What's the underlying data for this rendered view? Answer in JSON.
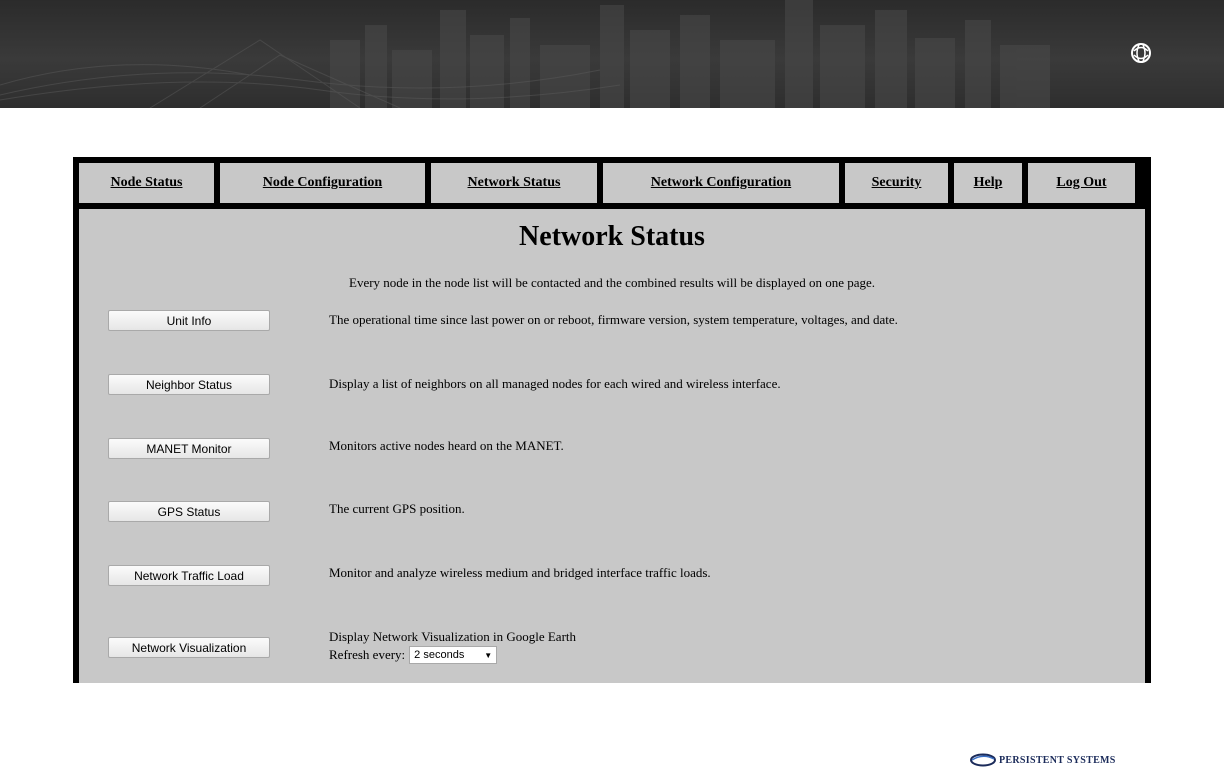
{
  "nav": {
    "tabs": [
      {
        "label": "Node Status"
      },
      {
        "label": "Node Configuration"
      },
      {
        "label": "Network Status"
      },
      {
        "label": "Network Configuration"
      },
      {
        "label": "Security"
      },
      {
        "label": "Help"
      },
      {
        "label": "Log Out"
      }
    ]
  },
  "main": {
    "title": "Network Status",
    "intro": "Every node in the node list will be contacted and the combined results will be displayed on one page.",
    "actions": [
      {
        "button": "Unit Info",
        "description": "The operational time since last power on or reboot, firmware version, system temperature, voltages, and date."
      },
      {
        "button": "Neighbor Status",
        "description": "Display a list of neighbors on all managed nodes for each wired and wireless interface."
      },
      {
        "button": "MANET Monitor",
        "description": "Monitors active nodes heard on the MANET."
      },
      {
        "button": "GPS Status",
        "description": "The current GPS position."
      },
      {
        "button": "Network Traffic Load",
        "description": "Monitor and analyze wireless medium and bridged interface traffic loads."
      },
      {
        "button": "Network Visualization",
        "description": "Display Network Visualization in Google Earth"
      }
    ],
    "refresh": {
      "label": "Refresh every:",
      "selected": "2 seconds"
    }
  },
  "footer": {
    "brand": "PERSISTENT SYSTEMS"
  },
  "colors": {
    "frame": "#000000",
    "panel": "#c8c8c8",
    "brand": "#1b2b5a"
  },
  "icons": {
    "banner_logo": "globe-logo-icon",
    "footer_logo": "persistent-systems-swoosh-icon",
    "select_arrow": "triangle-down-icon"
  }
}
